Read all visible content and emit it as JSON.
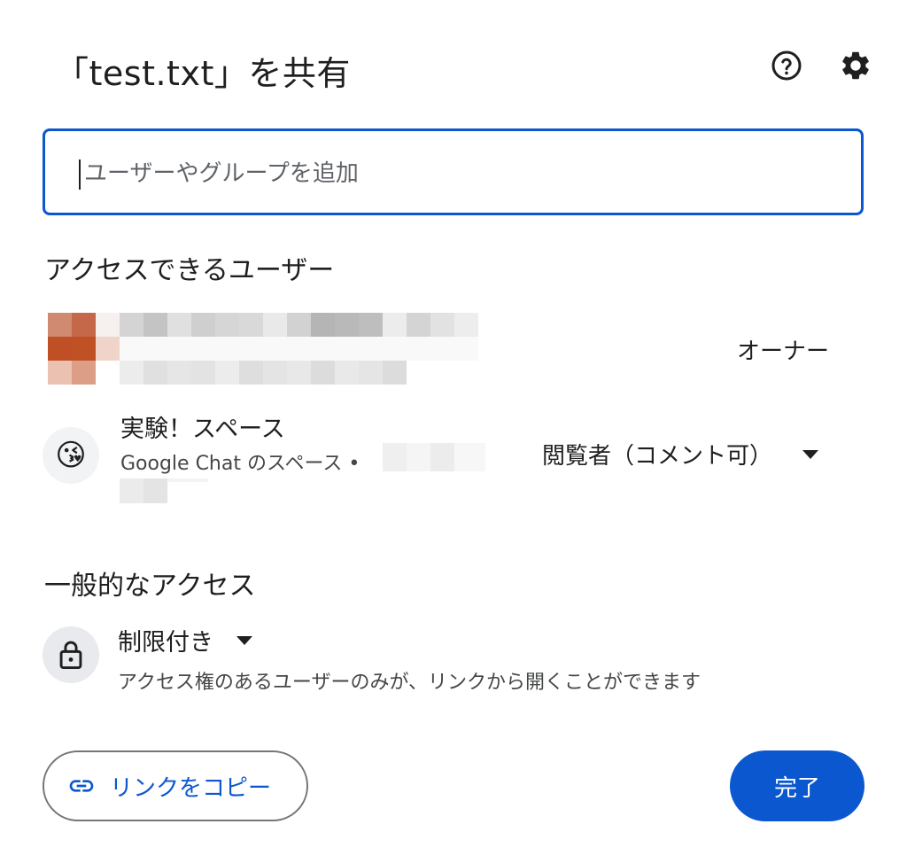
{
  "dialog": {
    "title": "「test.txt」を共有",
    "help_icon": "help-circle-icon",
    "settings_icon": "gear-icon"
  },
  "add_people": {
    "placeholder": "ユーザーやグループを追加"
  },
  "access_section": {
    "heading": "アクセスできるユーザー",
    "owner": {
      "role": "オーナー"
    },
    "space": {
      "icon": "kissing-face-emoji",
      "emoji": "😘",
      "name": "実験！スペース",
      "subtitle": "Google Chat のスペース •",
      "role": "閲覧者（コメント可）"
    }
  },
  "general_access": {
    "heading": "一般的なアクセス",
    "icon": "lock-icon",
    "selected": "制限付き",
    "description": "アクセス権のあるユーザーのみが、リンクから開くことができます"
  },
  "footer": {
    "copy_link_label": "リンクをコピー",
    "copy_link_icon": "link-icon",
    "done_label": "完了"
  },
  "colors": {
    "accent": "#0b57d0",
    "text": "#1f1f1f",
    "secondary_text": "#444746"
  }
}
